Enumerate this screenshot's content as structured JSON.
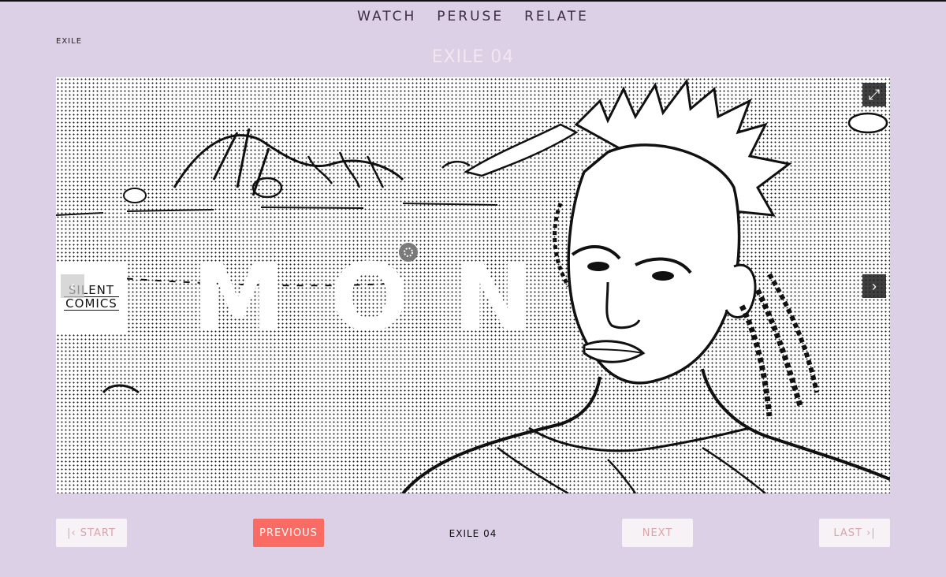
{
  "nav": {
    "items": [
      "WATCH",
      "PERUSE",
      "RELATE"
    ]
  },
  "breadcrumb": "EXILE",
  "page_title": "EXILE 04",
  "viewer": {
    "overlay_text": "MON",
    "logo_line1": "SILENT",
    "logo_line2": "COMICS",
    "prev_arrow": "‹",
    "next_arrow": "›",
    "expand_icon": "⤢"
  },
  "pagination": {
    "start": "|‹ START",
    "previous": "PREVIOUS",
    "current": "EXILE 04",
    "next": "NEXT",
    "last": "LAST ›|"
  },
  "colors": {
    "background": "#dcd0e6",
    "accent": "#fa6b63",
    "muted_button_text": "#d9a4aa"
  }
}
